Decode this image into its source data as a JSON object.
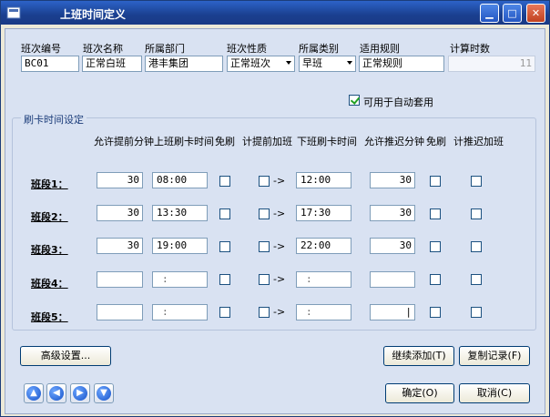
{
  "window": {
    "title": "上班时间定义",
    "controls": [
      "_",
      "□",
      "×"
    ]
  },
  "header_fields": {
    "labels": [
      "班次编号",
      "班次名称",
      "所属部门",
      "班次性质",
      "所属类别",
      "适用规则",
      "计算时数"
    ],
    "shift_code": "BC01",
    "shift_name": "正常白班",
    "department": "港丰集团",
    "shift_nature": "正常班次",
    "category": "早班",
    "rule": "正常规则",
    "hours": "11"
  },
  "auto_apply": {
    "label": "可用于自动套用",
    "checked": true
  },
  "group": {
    "title": "刷卡时间设定",
    "columns": [
      "允许提前分钟",
      "上班刷卡时间",
      "免刷",
      "计提前加班",
      "下班刷卡时间",
      "允许推迟分钟",
      "免刷",
      "计推迟加班"
    ]
  },
  "segments": [
    {
      "label": "班段1：",
      "early_min": "30",
      "on_time": "08:00",
      "off_time": "12:00",
      "late_min": "30"
    },
    {
      "label": "班段2：",
      "early_min": "30",
      "on_time": "13:30",
      "off_time": "17:30",
      "late_min": "30"
    },
    {
      "label": "班段3：",
      "early_min": "30",
      "on_time": "19:00",
      "off_time": "22:00",
      "late_min": "30"
    },
    {
      "label": "班段4：",
      "early_min": "",
      "on_time": ":",
      "off_time": ":",
      "late_min": ""
    },
    {
      "label": "班段5：",
      "early_min": "",
      "on_time": ":",
      "off_time": ":",
      "late_min": "|"
    }
  ],
  "arrow_text": "->",
  "buttons": {
    "advanced": "高级设置...",
    "continue_add": "继续添加(T)",
    "copy_record": "复制记录(F)",
    "ok": "确定(O)",
    "cancel": "取消(C)"
  },
  "nav_icons": [
    "first-icon",
    "prev-icon",
    "next-icon",
    "last-icon"
  ]
}
